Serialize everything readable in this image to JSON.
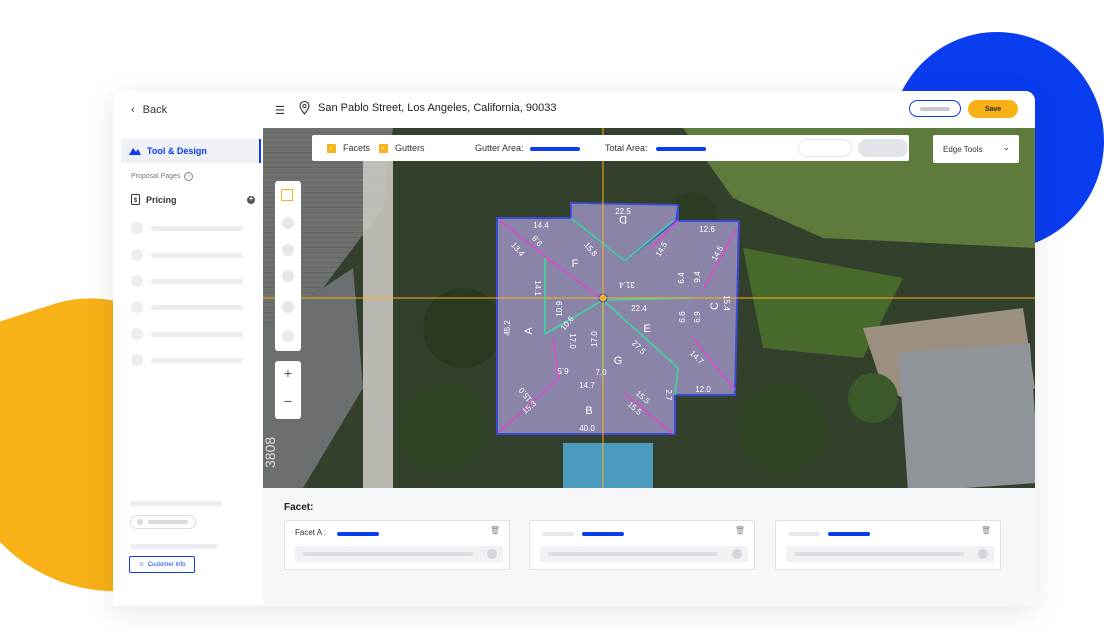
{
  "sidebar": {
    "back_label": "Back",
    "tool_design_label": "Tool & Design",
    "proposal_pages_label": "Proposal Pages",
    "pricing_label": "Pricing",
    "customer_info_label": "Customer Info"
  },
  "header": {
    "address": "San Pablo Street, Los Angeles, California, 90033",
    "save_label": "Save"
  },
  "toolbar": {
    "facets_label": "Facets",
    "gutters_label": "Gutters",
    "gutter_area_label": "Gutter Area:",
    "total_area_label": "Total Area:",
    "edge_tools_label": "Edge Tools"
  },
  "map": {
    "street_number": "3808",
    "facets": [
      {
        "id": "A"
      },
      {
        "id": "B"
      },
      {
        "id": "C"
      },
      {
        "id": "D"
      },
      {
        "id": "E"
      },
      {
        "id": "F"
      },
      {
        "id": "G"
      }
    ],
    "edge_labels": [
      "14.4",
      "22.5",
      "12.6",
      "13.4",
      "9.8",
      "15.8",
      "14.5",
      "14.5",
      "31.4",
      "14.1",
      "10.9",
      "22.4",
      "6.4",
      "9.4",
      "15.4",
      "10.6",
      "6.6",
      "6.9",
      "45.2",
      "17.0",
      "17.0",
      "27.5",
      "14.7",
      "6.5",
      "7.0",
      "14.7",
      "12.0",
      "15.0",
      "15.3",
      "15.5",
      "2.7",
      "15.5",
      "40.0"
    ]
  },
  "facet_panel": {
    "title": "Facet:",
    "cards": [
      {
        "label": "Facet A :"
      },
      {
        "label": ""
      },
      {
        "label": ""
      }
    ]
  },
  "colors": {
    "accent_blue": "#0A3CF0",
    "accent_yellow": "#F8B117",
    "facet_fill": "#8A85A8",
    "edge_magenta": "#D94BD0",
    "edge_green": "#3FD3A0"
  }
}
